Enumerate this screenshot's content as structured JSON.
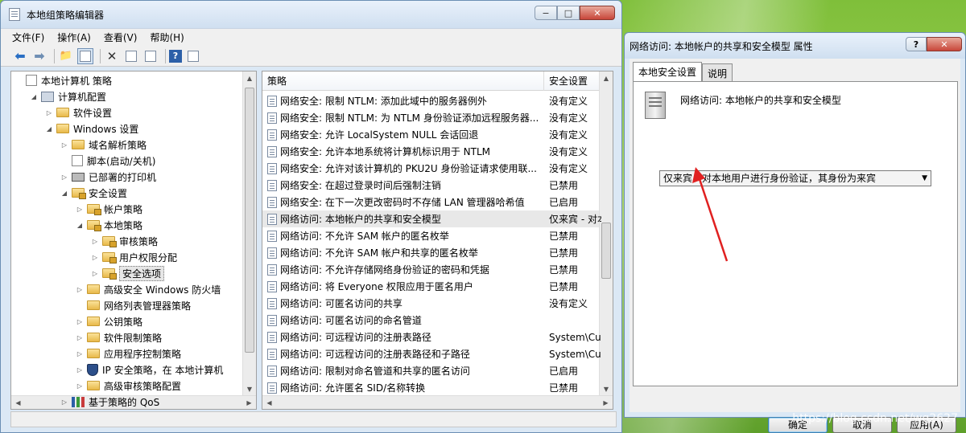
{
  "main_window": {
    "title": "本地组策略编辑器",
    "min": "−",
    "max": "□",
    "close": "✕",
    "menu": [
      "文件(F)",
      "操作(A)",
      "查看(V)",
      "帮助(H)"
    ]
  },
  "tree": [
    {
      "label": "本地计算机 策略",
      "depth": 0,
      "icon": "computer-policy-icon",
      "arrow": ""
    },
    {
      "label": "计算机配置",
      "depth": 1,
      "icon": "computer-icon",
      "arrow": "◢"
    },
    {
      "label": "软件设置",
      "depth": 2,
      "icon": "folder-icon",
      "arrow": "▷"
    },
    {
      "label": "Windows 设置",
      "depth": 2,
      "icon": "folder-icon",
      "arrow": "◢"
    },
    {
      "label": "域名解析策略",
      "depth": 3,
      "icon": "folder-icon",
      "arrow": "▷"
    },
    {
      "label": "脚本(启动/关机)",
      "depth": 3,
      "icon": "script-icon",
      "arrow": ""
    },
    {
      "label": "已部署的打印机",
      "depth": 3,
      "icon": "printer-icon",
      "arrow": "▷"
    },
    {
      "label": "安全设置",
      "depth": 3,
      "icon": "lock-folder-icon",
      "arrow": "◢"
    },
    {
      "label": "帐户策略",
      "depth": 4,
      "icon": "lock-folder-icon",
      "arrow": "▷"
    },
    {
      "label": "本地策略",
      "depth": 4,
      "icon": "lock-folder-icon",
      "arrow": "◢"
    },
    {
      "label": "审核策略",
      "depth": 5,
      "icon": "lock-folder-icon",
      "arrow": "▷"
    },
    {
      "label": "用户权限分配",
      "depth": 5,
      "icon": "lock-folder-icon",
      "arrow": "▷"
    },
    {
      "label": "安全选项",
      "depth": 5,
      "icon": "lock-folder-icon",
      "arrow": "▷",
      "selected": true
    },
    {
      "label": "高级安全 Windows 防火墙",
      "depth": 4,
      "icon": "folder-icon",
      "arrow": "▷"
    },
    {
      "label": "网络列表管理器策略",
      "depth": 4,
      "icon": "folder-icon",
      "arrow": ""
    },
    {
      "label": "公钥策略",
      "depth": 4,
      "icon": "folder-icon",
      "arrow": "▷"
    },
    {
      "label": "软件限制策略",
      "depth": 4,
      "icon": "folder-icon",
      "arrow": "▷"
    },
    {
      "label": "应用程序控制策略",
      "depth": 4,
      "icon": "folder-icon",
      "arrow": "▷"
    },
    {
      "label": "IP 安全策略，在 本地计算机",
      "depth": 4,
      "icon": "shield-icon",
      "arrow": "▷"
    },
    {
      "label": "高级审核策略配置",
      "depth": 4,
      "icon": "folder-icon",
      "arrow": "▷"
    },
    {
      "label": "基于策略的 QoS",
      "depth": 3,
      "icon": "chart-icon",
      "arrow": "▷"
    }
  ],
  "list": {
    "col_policy": "策略",
    "col_setting": "安全设置",
    "rows": [
      {
        "name": "网络安全: 限制 NTLM: 添加此域中的服务器例外",
        "value": "没有定义"
      },
      {
        "name": "网络安全: 限制 NTLM: 为 NTLM 身份验证添加远程服务器...",
        "value": "没有定义"
      },
      {
        "name": "网络安全: 允许 LocalSystem NULL 会话回退",
        "value": "没有定义"
      },
      {
        "name": "网络安全: 允许本地系统将计算机标识用于 NTLM",
        "value": "没有定义"
      },
      {
        "name": "网络安全: 允许对该计算机的 PKU2U 身份验证请求使用联...",
        "value": "没有定义"
      },
      {
        "name": "网络安全: 在超过登录时间后强制注销",
        "value": "已禁用"
      },
      {
        "name": "网络安全: 在下一次更改密码时不存储 LAN 管理器哈希值",
        "value": "已启用"
      },
      {
        "name": "网络访问: 本地帐户的共享和安全模型",
        "value": "仅来宾 - 对本",
        "selected": true
      },
      {
        "name": "网络访问: 不允许 SAM 帐户的匿名枚举",
        "value": "已禁用"
      },
      {
        "name": "网络访问: 不允许 SAM 帐户和共享的匿名枚举",
        "value": "已禁用"
      },
      {
        "name": "网络访问: 不允许存储网络身份验证的密码和凭据",
        "value": "已禁用"
      },
      {
        "name": "网络访问: 将 Everyone 权限应用于匿名用户",
        "value": "已禁用"
      },
      {
        "name": "网络访问: 可匿名访问的共享",
        "value": "没有定义"
      },
      {
        "name": "网络访问: 可匿名访问的命名管道",
        "value": ""
      },
      {
        "name": "网络访问: 可远程访问的注册表路径",
        "value": "System\\Cur"
      },
      {
        "name": "网络访问: 可远程访问的注册表路径和子路径",
        "value": "System\\Cur"
      },
      {
        "name": "网络访问: 限制对命名管道和共享的匿名访问",
        "value": "已启用"
      },
      {
        "name": "网络访问: 允许匿名 SID/名称转换",
        "value": "已禁用"
      }
    ]
  },
  "dialog": {
    "title": "网络访问: 本地帐户的共享和安全模型 属性",
    "help": "?",
    "close": "✕",
    "tab_local": "本地安全设置",
    "tab_explain": "说明",
    "policy_name": "网络访问: 本地帐户的共享和安全模型",
    "dropdown_value": "仅来宾 - 对本地用户进行身份验证，其身份为来宾",
    "ok": "确定",
    "cancel": "取消",
    "apply": "应用(A)"
  },
  "watermark": "https://blog.csdn.net/wg2627"
}
